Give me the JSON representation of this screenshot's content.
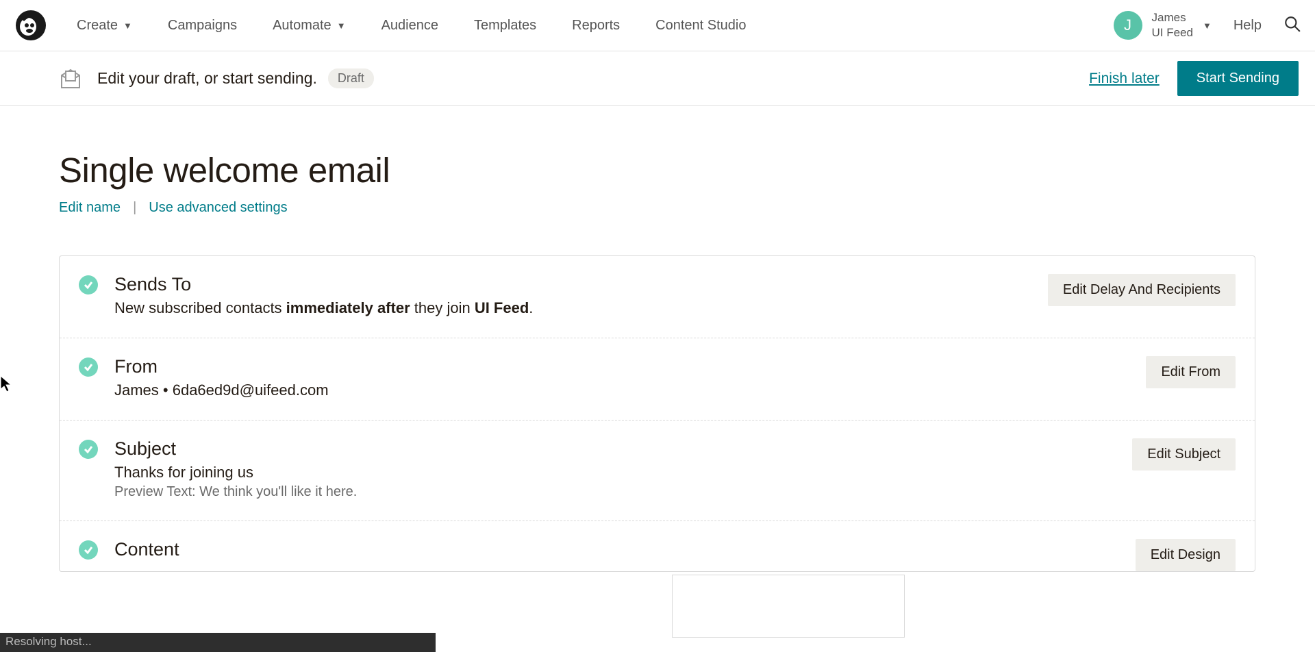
{
  "nav": {
    "items": [
      "Create",
      "Campaigns",
      "Automate",
      "Audience",
      "Templates",
      "Reports",
      "Content Studio"
    ],
    "user": {
      "initial": "J",
      "name": "James",
      "account": "UI Feed"
    },
    "help": "Help"
  },
  "actionbar": {
    "title": "Edit your draft, or start sending.",
    "badge": "Draft",
    "finish": "Finish later",
    "start": "Start Sending"
  },
  "page": {
    "title": "Single welcome email",
    "edit_name": "Edit name",
    "advanced": "Use advanced settings"
  },
  "sections": {
    "sends_to": {
      "title": "Sends To",
      "desc_pre": "New subscribed contacts ",
      "desc_bold1": "immediately after",
      "desc_mid": " they join ",
      "desc_bold2": "UI Feed",
      "desc_post": ".",
      "button": "Edit Delay And Recipients"
    },
    "from": {
      "title": "From",
      "desc": "James • 6da6ed9d@uifeed.com",
      "button": "Edit From"
    },
    "subject": {
      "title": "Subject",
      "desc": "Thanks for joining us",
      "preview": "Preview Text: We think you'll like it here.",
      "button": "Edit Subject"
    },
    "content": {
      "title": "Content",
      "button": "Edit Design"
    }
  },
  "status": "Resolving host..."
}
